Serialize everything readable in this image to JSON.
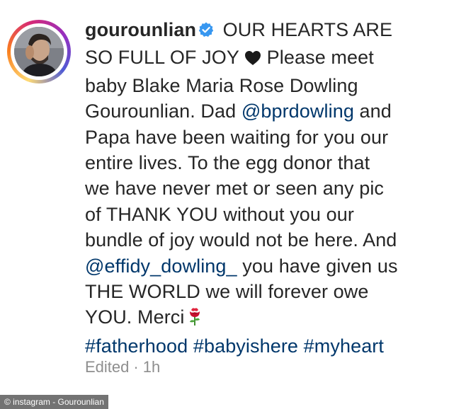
{
  "post": {
    "username": "gourounlian",
    "caption_lines": [
      {
        "text": " OUR HEARTS ARE"
      },
      {
        "text": "SO FULL OF JOY ",
        "after": " Please meet"
      },
      {
        "text": "baby Blake Maria Rose Dowling"
      },
      {
        "text": "Gourounlian. Dad ",
        "mention": "@bprdowling",
        "after": " and"
      },
      {
        "text": "Papa have been waiting for you our"
      },
      {
        "text": "entire lives. To the egg donor that"
      },
      {
        "text": "we have never met or seen any pic"
      },
      {
        "text": "of THANK YOU without you our"
      },
      {
        "text": "bundle of joy would not be here. And"
      },
      {
        "mention": "@effidy_dowling_",
        "after": " you have given us"
      },
      {
        "text": "THE WORLD we will forever owe"
      },
      {
        "text": "YOU. Merci"
      }
    ],
    "hashtags": [
      "#fatherhood",
      "#babyishere",
      "#myheart"
    ],
    "edited_label": "Edited",
    "separator": "·",
    "time": "1h"
  },
  "credit": "© instagram - Gourounlian",
  "icons": {
    "verified": "verified-badge-icon",
    "heart": "black-heart-icon",
    "rose": "rose-emoji-icon"
  },
  "colors": {
    "text": "#262626",
    "link": "#00376b",
    "meta": "#8e8e8e",
    "verified": "#3897f0"
  }
}
